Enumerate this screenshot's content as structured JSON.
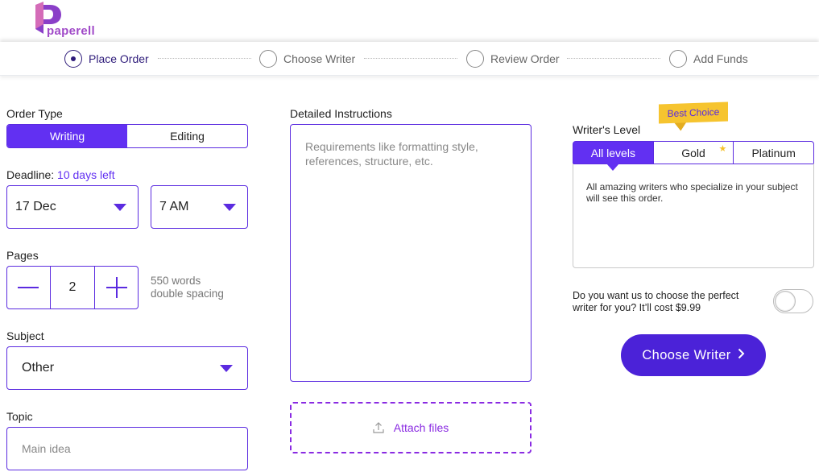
{
  "brand": {
    "name": "paperell",
    "colors": {
      "primary": "#6230f2",
      "cta": "#4b22d8",
      "badge": "#f6c42f",
      "step_active": "#2e1b7a"
    }
  },
  "steps": [
    {
      "label": "Place Order",
      "active": true
    },
    {
      "label": "Choose Writer",
      "active": false
    },
    {
      "label": "Review Order",
      "active": false
    },
    {
      "label": "Add Funds",
      "active": false
    }
  ],
  "order_type": {
    "label": "Order Type",
    "options": [
      "Writing",
      "Editing"
    ],
    "selected": "Writing"
  },
  "deadline": {
    "label": "Deadline:",
    "remaining": "10 days left",
    "date": "17 Dec",
    "time": "7 AM"
  },
  "pages": {
    "label": "Pages",
    "value": "2",
    "words": "550 words",
    "spacing": "double spacing"
  },
  "subject": {
    "label": "Subject",
    "value": "Other"
  },
  "topic": {
    "label": "Topic",
    "placeholder": "Main idea"
  },
  "instructions": {
    "label": "Detailed Instructions",
    "placeholder": "Requirements like formatting style, references, structure, etc."
  },
  "attach": {
    "label": "Attach files",
    "icon": "upload-icon"
  },
  "writer_level": {
    "label": "Writer's Level",
    "badge": "Best Choice",
    "tabs": [
      {
        "label": "All levels",
        "selected": true
      },
      {
        "label": "Gold",
        "selected": false,
        "icon": "star-icon"
      },
      {
        "label": "Platinum",
        "selected": false
      }
    ],
    "description": "All amazing writers who specialize in your subject will see this order."
  },
  "perfect_writer": {
    "text": "Do you want us to choose the perfect writer for you? It’ll cost $9.99",
    "enabled": false
  },
  "cta": {
    "label": "Choose Writer",
    "icon": "chevron-right-icon"
  }
}
